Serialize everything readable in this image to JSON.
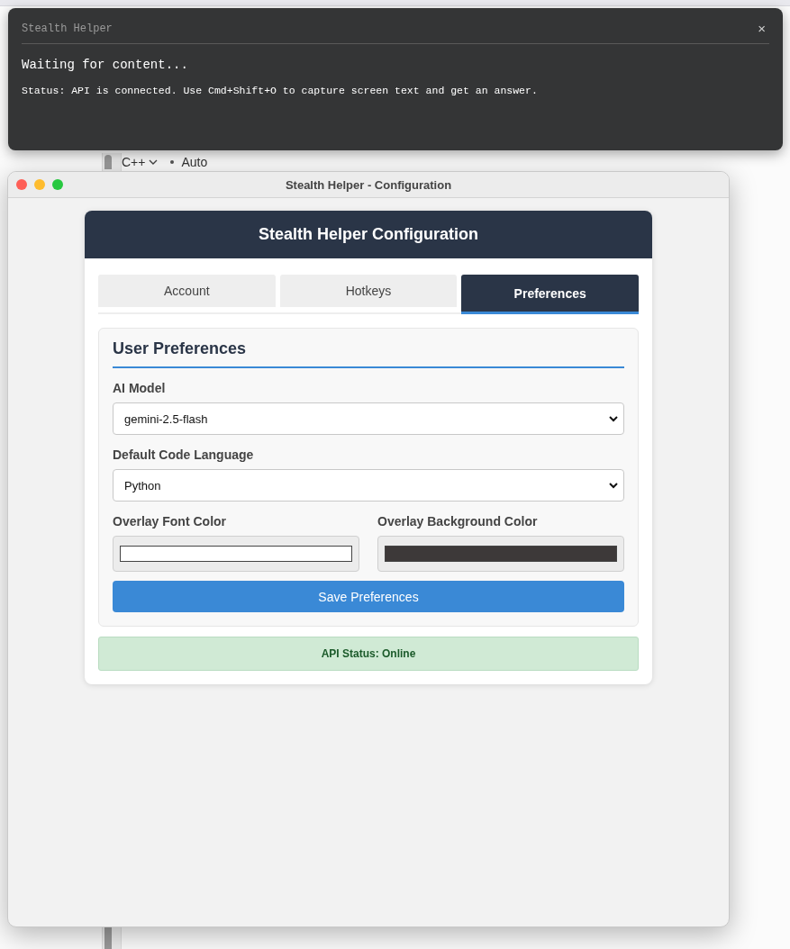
{
  "overlay": {
    "title": "Stealth Helper",
    "close": "×",
    "message": "Waiting for content...",
    "status": "Status: API is connected. Use Cmd+Shift+O to capture screen text and get an answer."
  },
  "background": {
    "language": "C++",
    "mode": "Auto"
  },
  "window": {
    "title": "Stealth Helper - Configuration"
  },
  "card": {
    "title": "Stealth Helper Configuration"
  },
  "tabs": [
    {
      "label": "Account",
      "selected": false
    },
    {
      "label": "Hotkeys",
      "selected": false
    },
    {
      "label": "Preferences",
      "selected": true
    }
  ],
  "section": {
    "title": "User Preferences",
    "fields": [
      {
        "kind": "select",
        "label": "AI Model",
        "value": "gemini-2.5-flash"
      },
      {
        "kind": "select",
        "label": "Default Code Language",
        "value": "Python"
      }
    ],
    "colors": [
      {
        "label": "Overlay Font Color",
        "color": "#ffffff"
      },
      {
        "label": "Overlay Background Color",
        "color": "#3d3939"
      }
    ],
    "save_button": "Save Preferences"
  },
  "api_status": "API Status: Online"
}
